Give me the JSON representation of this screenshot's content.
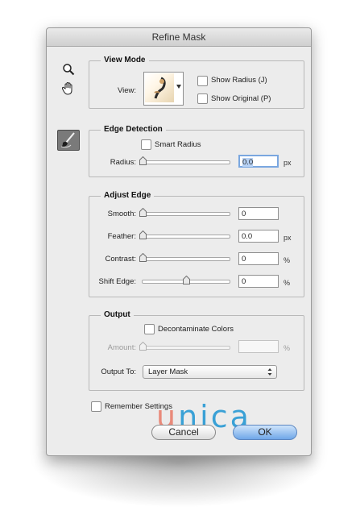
{
  "window": {
    "title": "Refine Mask"
  },
  "view_mode": {
    "title": "View Mode",
    "view_label": "View:",
    "show_radius": "Show Radius (J)",
    "show_original": "Show Original (P)"
  },
  "edge_detection": {
    "title": "Edge Detection",
    "smart_radius": "Smart Radius",
    "radius_label": "Radius:",
    "radius_value": "0.0",
    "radius_unit": "px"
  },
  "adjust_edge": {
    "title": "Adjust Edge",
    "rows": [
      {
        "label": "Smooth:",
        "value": "0",
        "unit": "",
        "slider": 0.0
      },
      {
        "label": "Feather:",
        "value": "0.0",
        "unit": "px",
        "slider": 0.0
      },
      {
        "label": "Contrast:",
        "value": "0",
        "unit": "%",
        "slider": 0.0
      },
      {
        "label": "Shift Edge:",
        "value": "0",
        "unit": "%",
        "slider": 0.5
      }
    ]
  },
  "output": {
    "title": "Output",
    "decontaminate": "Decontaminate Colors",
    "amount_label": "Amount:",
    "amount_unit": "%",
    "output_to_label": "Output To:",
    "output_to_value": "Layer Mask"
  },
  "remember_settings": "Remember Settings",
  "buttons": {
    "cancel": "Cancel",
    "ok": "OK"
  },
  "watermark": "unica",
  "colors": {
    "accent_ok": "#6fa7e8",
    "watermark_u": "#e98a7a",
    "watermark_rest": "#3aa1d6"
  }
}
